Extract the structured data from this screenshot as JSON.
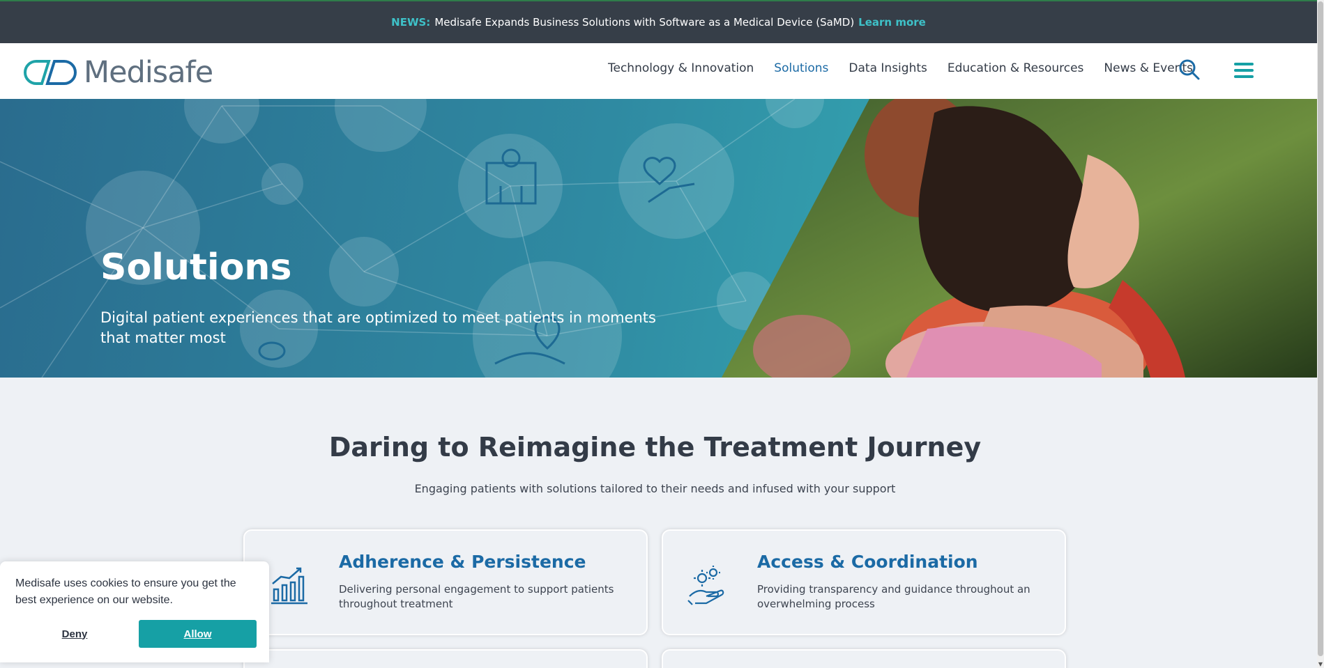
{
  "news_bar": {
    "label": "NEWS:",
    "text": "Medisafe Expands Business Solutions with Software as a Medical Device (SaMD)",
    "link": "Learn more"
  },
  "header": {
    "brand": "Medisafe",
    "nav": [
      {
        "label": "Technology & Innovation",
        "active": false
      },
      {
        "label": "Solutions",
        "active": true
      },
      {
        "label": "Data Insights",
        "active": false
      },
      {
        "label": "Education & Resources",
        "active": false
      },
      {
        "label": "News & Events",
        "active": false
      }
    ],
    "search_icon": "search-icon",
    "menu_icon": "hamburger-menu-icon"
  },
  "hero": {
    "title": "Solutions",
    "subtitle": "Digital patient experiences that are optimized to meet patients in moments that matter most",
    "photo": "two women hugging outdoors"
  },
  "section": {
    "title": "Daring to Reimagine the Treatment Journey",
    "subtitle": "Engaging patients with solutions tailored to their needs and infused with your support"
  },
  "cards": [
    {
      "title": "Adherence & Persistence",
      "description": "Delivering personal engagement to support patients throughout treatment",
      "icon": "growth-chart-icon"
    },
    {
      "title": "Access & Coordination",
      "description": "Providing transparency and guidance throughout an overwhelming process",
      "icon": "gears-hand-icon"
    }
  ],
  "cookie_banner": {
    "message": "Medisafe uses cookies to ensure you get the best experience on our website.",
    "deny": "Deny",
    "allow": "Allow"
  },
  "colors": {
    "accent": "#1b6aa5",
    "teal": "#16a0a5",
    "news_bg": "#363e48"
  }
}
